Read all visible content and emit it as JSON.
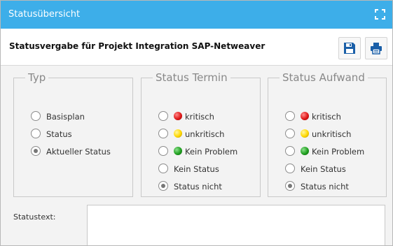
{
  "window": {
    "title": "Statusübersicht"
  },
  "header": {
    "heading": "Statusvergabe für Projekt Integration SAP-Netweaver"
  },
  "groups": {
    "typ": {
      "legend": "Typ",
      "options": [
        {
          "label": "Basisplan",
          "checked": false
        },
        {
          "label": "Status",
          "checked": false
        },
        {
          "label": "Aktueller Status",
          "checked": true
        }
      ]
    },
    "termin": {
      "legend": "Status Termin",
      "options": [
        {
          "label": "kritisch",
          "lamp": "red",
          "checked": false
        },
        {
          "label": "unkritisch",
          "lamp": "yellow",
          "checked": false
        },
        {
          "label": "Kein Problem",
          "lamp": "green",
          "checked": false
        },
        {
          "label": "Kein Status",
          "checked": false
        },
        {
          "label": "Status nicht",
          "checked": true
        }
      ]
    },
    "aufwand": {
      "legend": "Status Aufwand",
      "options": [
        {
          "label": "kritisch",
          "lamp": "red",
          "checked": false
        },
        {
          "label": "unkritisch",
          "lamp": "yellow",
          "checked": false
        },
        {
          "label": "Kein Problem",
          "lamp": "green",
          "checked": false
        },
        {
          "label": "Kein Status",
          "checked": false
        },
        {
          "label": "Status nicht",
          "checked": true
        }
      ]
    }
  },
  "statustext": {
    "label": "Statustext:",
    "value": ""
  },
  "colors": {
    "titlebar": "#3daee9",
    "save_icon": "#1a5fa8",
    "print_icon": "#1a5fa8"
  }
}
